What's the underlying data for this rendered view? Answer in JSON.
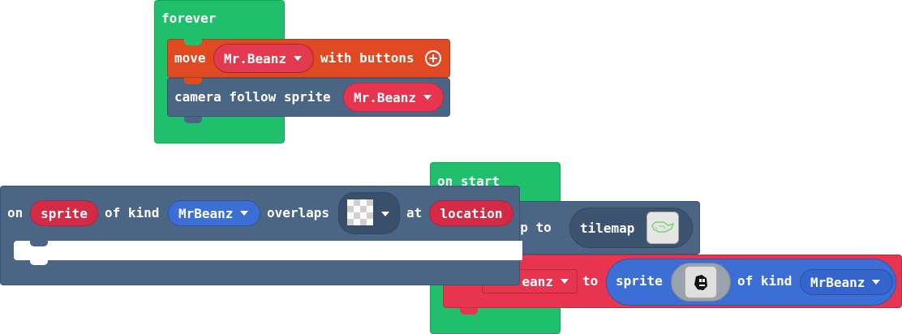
{
  "forever_block": {
    "label": "forever",
    "move_block": {
      "label": "move",
      "sprite": "Mr.Beanz",
      "suffix": "with buttons"
    },
    "camera_block": {
      "label": "camera follow sprite",
      "sprite": "Mr.Beanz"
    }
  },
  "overlap_block": {
    "on_label": "on",
    "sprite_param": "sprite",
    "of_kind_label": "of kind",
    "kind": "MrBeanz",
    "overlaps_label": "overlaps",
    "at_label": "at",
    "location_param": "location"
  },
  "on_start_block": {
    "label": "on start",
    "set_tilemap": {
      "label_visible": "nap to",
      "tilemap_label": "tilemap"
    },
    "set_sprite": {
      "variable_visible": "eanz",
      "to_label": "to",
      "sprite_label": "sprite",
      "of_kind_label": "of kind",
      "kind": "MrBeanz"
    }
  },
  "colors": {
    "events_green": "#20bf6b",
    "scene_slate": "#4b6584",
    "controller_orange": "#e04a23",
    "variables_red": "#e8354f",
    "sprites_blue": "#3c6fd6"
  },
  "icons": {
    "add": "plus-circle-icon",
    "tile_thumbnail": "tilemap-thumbnail-icon",
    "sprite_thumbnail": "sprite-image-icon",
    "empty_image": "checkerboard-icon"
  }
}
